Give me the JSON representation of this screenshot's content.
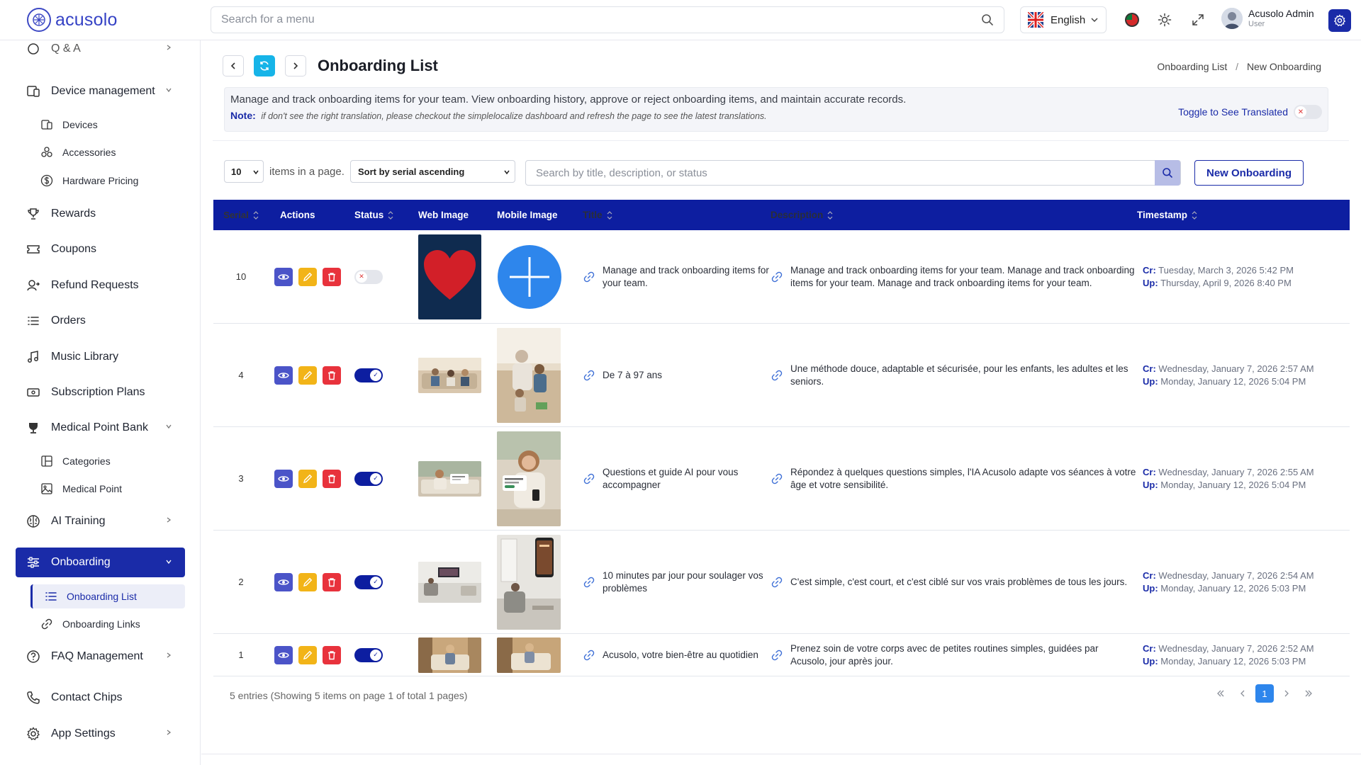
{
  "app": {
    "brand": "acusolo"
  },
  "topbar": {
    "search_placeholder": "Search for a menu",
    "language": "English",
    "user_name": "Acusolo Admin",
    "user_role": "User"
  },
  "sidebar": {
    "top_partial": "Q & A",
    "device_management": "Device management",
    "devices": "Devices",
    "accessories": "Accessories",
    "hardware_pricing": "Hardware Pricing",
    "rewards": "Rewards",
    "coupons": "Coupons",
    "refund_requests": "Refund Requests",
    "orders": "Orders",
    "music_library": "Music Library",
    "subscription_plans": "Subscription Plans",
    "medical_point_bank": "Medical Point Bank",
    "categories": "Categories",
    "medical_point": "Medical Point",
    "ai_training": "AI Training",
    "onboarding": "Onboarding",
    "onboarding_list": "Onboarding List",
    "onboarding_links": "Onboarding Links",
    "faq_management": "FAQ Management",
    "contact_chips": "Contact Chips",
    "app_settings": "App Settings"
  },
  "page": {
    "title": "Onboarding List",
    "breadcrumb": [
      "Onboarding List",
      "New Onboarding"
    ],
    "breadcrumb_sep": "/",
    "info_text": "Manage and track onboarding items for your team. View onboarding history, approve or reject onboarding items, and maintain accurate records.",
    "note_label": "Note:",
    "note_text": "if don't see the right translation, please checkout the simplelocalize dashboard and refresh the page to see the latest translations.",
    "toggle_translated": "Toggle to See Translated"
  },
  "toolbar": {
    "page_size": "10",
    "items_label": "items in a page.",
    "sort": "Sort by serial ascending",
    "search_placeholder": "Search by title, description, or status",
    "new_button": "New Onboarding"
  },
  "table": {
    "headers": {
      "serial": "Serial",
      "actions": "Actions",
      "status": "Status",
      "web_image": "Web Image",
      "mobile_image": "Mobile Image",
      "title": "Title",
      "description": "Description",
      "timestamp": "Timestamp"
    },
    "created_label": "Cr:",
    "updated_label": "Up:",
    "rows": [
      {
        "serial": "10",
        "status_on": false,
        "title": "Manage and track onboarding items for your team.",
        "description": "Manage and track onboarding items for your team. Manage and track onboarding items for your team. Manage and track onboarding items for your team.",
        "created": "Tuesday, March 3, 2026 5:42 PM",
        "updated": "Thursday, April 9, 2026 8:40 PM"
      },
      {
        "serial": "4",
        "status_on": true,
        "title": "De 7 à 97 ans",
        "description": "Une méthode douce, adaptable et sécurisée, pour les enfants, les adultes et les seniors.",
        "created": "Wednesday, January 7, 2026 2:57 AM",
        "updated": "Monday, January 12, 2026 5:04 PM"
      },
      {
        "serial": "3",
        "status_on": true,
        "title": "Questions et guide AI pour vous accompagner",
        "description": "Répondez à quelques questions simples, l'IA Acusolo adapte vos séances à votre âge et votre sensibilité.",
        "created": "Wednesday, January 7, 2026 2:55 AM",
        "updated": "Monday, January 12, 2026 5:04 PM"
      },
      {
        "serial": "2",
        "status_on": true,
        "title": "10 minutes par jour pour soulager vos problèmes",
        "description": "C'est simple, c'est court, et c'est ciblé sur vos vrais problèmes de tous les jours.",
        "created": "Wednesday, January 7, 2026 2:54 AM",
        "updated": "Monday, January 12, 2026 5:03 PM"
      },
      {
        "serial": "1",
        "status_on": true,
        "title": "Acusolo, votre bien-être au quotidien",
        "description": "Prenez soin de votre corps avec de petites routines simples, guidées par Acusolo, jour après jour.",
        "created": "Wednesday, January 7, 2026 2:52 AM",
        "updated": "Monday, January 12, 2026 5:03 PM"
      }
    ]
  },
  "footer": {
    "entries": "5 entries (Showing 5 items on page 1 of total 1 pages)",
    "current_page": "1"
  },
  "colors": {
    "primary": "#0d1ea0",
    "accent_cyan": "#16b4e8",
    "view": "#4b54c8",
    "edit": "#f2b418",
    "delete": "#e8323c",
    "page_active": "#2e86ec"
  }
}
